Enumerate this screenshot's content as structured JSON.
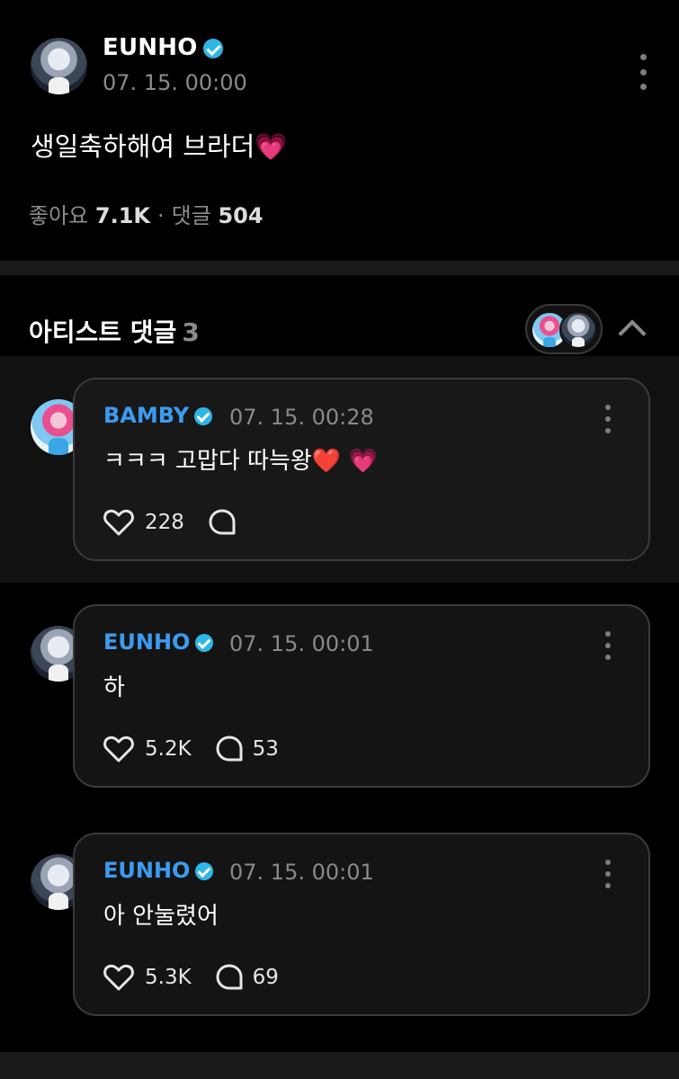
{
  "post": {
    "author": "EUNHO",
    "time": "07. 15. 00:00",
    "body": "생일축하해여 브라더",
    "heart_emoji": "💗",
    "likes_label": "좋아요",
    "likes_count": "7.1K",
    "comments_label": "댓글",
    "comments_count": "504",
    "stat_separator": "·"
  },
  "artist_comments": {
    "title": "아티스트 댓글",
    "count": "3"
  },
  "comments": [
    {
      "author": "BAMBY",
      "time": "07. 15. 00:28",
      "text": "ㅋㅋㅋ 고맙다 따늑왕❤️ 💗",
      "likes": "228",
      "replies": ""
    },
    {
      "author": "EUNHO",
      "time": "07. 15. 00:01",
      "text": "하",
      "likes": "5.2K",
      "replies": "53"
    },
    {
      "author": "EUNHO",
      "time": "07. 15. 00:01",
      "text": "아 안눌렸어",
      "likes": "5.3K",
      "replies": "69"
    }
  ],
  "colors": {
    "background": "#000000",
    "card": "#141414",
    "card_border": "#3b3b3b",
    "author_blue": "#3d9bf0",
    "verified_badge": "#2fb6e6",
    "muted_text": "#8a8a8a"
  },
  "icons": [
    "verified-badge-icon",
    "more-vertical-icon",
    "heart-outline-icon",
    "reply-bubble-icon",
    "chevron-up-icon"
  ]
}
